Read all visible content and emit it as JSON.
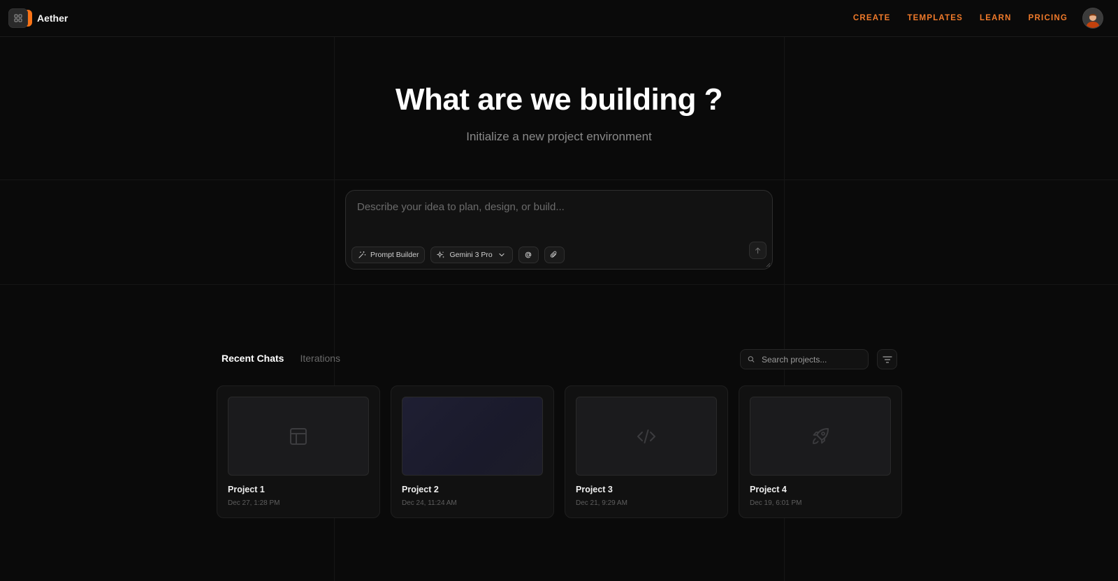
{
  "app": {
    "name": "Aether",
    "accent_color": "#f07a2a"
  },
  "nav": {
    "items": [
      {
        "label": "CREATE"
      },
      {
        "label": "TEMPLATES"
      },
      {
        "label": "LEARN"
      },
      {
        "label": "PRICING"
      }
    ]
  },
  "hero": {
    "title": "What are we building ?",
    "subtitle": "Initialize a new project environment"
  },
  "prompt": {
    "placeholder": "Describe your idea to plan, design, or build...",
    "value": "",
    "prompt_builder_label": "Prompt Builder",
    "model_label": "Gemini 3 Pro"
  },
  "recent": {
    "tabs": [
      {
        "label": "Recent Chats",
        "active": true
      },
      {
        "label": "Iterations",
        "active": false
      }
    ],
    "search_placeholder": "Search projects...",
    "projects": [
      {
        "title": "Project 1",
        "date": "Dec 27, 1:28 PM",
        "icon": "layout-icon"
      },
      {
        "title": "Project 2",
        "date": "Dec 24, 11:24 AM",
        "icon": ""
      },
      {
        "title": "Project 3",
        "date": "Dec 21, 9:29 AM",
        "icon": "code-icon"
      },
      {
        "title": "Project 4",
        "date": "Dec 19, 6:01 PM",
        "icon": "rocket-icon"
      }
    ]
  }
}
